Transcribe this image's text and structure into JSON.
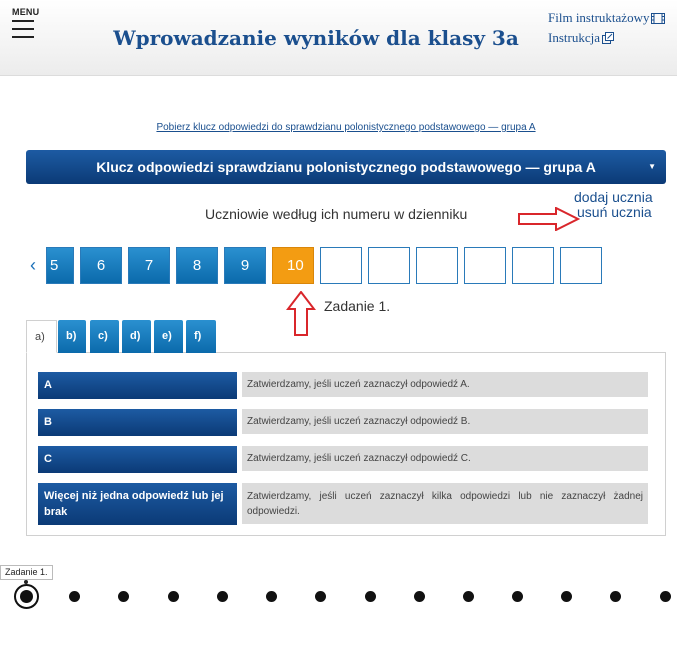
{
  "header": {
    "menu_label": "MENU",
    "title": "Wprowadzanie wyników dla klasy 3a",
    "film_link": "Film instruktażowy",
    "instr_link": "Instrukcja"
  },
  "key_link": "Pobierz klucz odpowiedzi do sprawdzianu polonistycznego podstawowego — grupa A",
  "dropdown": {
    "selected": "Klucz odpowiedzi sprawdzianu polonistycznego podstawowego — grupa A"
  },
  "students_label": "Uczniowie według ich numeru w dzienniku",
  "pupil_actions": {
    "add": "dodaj ucznia",
    "remove": "usuń ucznia"
  },
  "nav": {
    "prev": "‹"
  },
  "numbers": [
    "5",
    "6",
    "7",
    "8",
    "9",
    "10",
    "",
    "",
    "",
    "",
    "",
    ""
  ],
  "active_number": "10",
  "task_label": "Zadanie 1.",
  "tabs": [
    "a)",
    "b)",
    "c)",
    "d)",
    "e)",
    "f)"
  ],
  "answers": [
    {
      "label": "A",
      "text": "Zatwierdzamy, jeśli uczeń zaznaczył odpowiedź A."
    },
    {
      "label": "B",
      "text": "Zatwierdzamy, jeśli uczeń zaznaczył odpowiedź B."
    },
    {
      "label": "C",
      "text": "Zatwierdzamy, jeśli uczeń zaznaczył odpowiedź C."
    },
    {
      "label": "Więcej niż jedna odpowiedź lub jej brak",
      "text": "Zatwierdzamy, jeśli uczeń zaznaczył kilka odpowiedzi lub nie zaznaczył żadnej odpowiedzi."
    }
  ],
  "timeline": {
    "tooltip": "Zadanie 1.",
    "total_dots": 14,
    "current": 1
  },
  "colors": {
    "brand_blue": "#1b4f8e",
    "button_blue": "#0b6aab",
    "active_orange": "#f39c12",
    "arrow_red": "#d9262b"
  },
  "icons": {
    "menu": "hamburger-icon",
    "film": "film-icon",
    "instr": "external-link-icon"
  }
}
